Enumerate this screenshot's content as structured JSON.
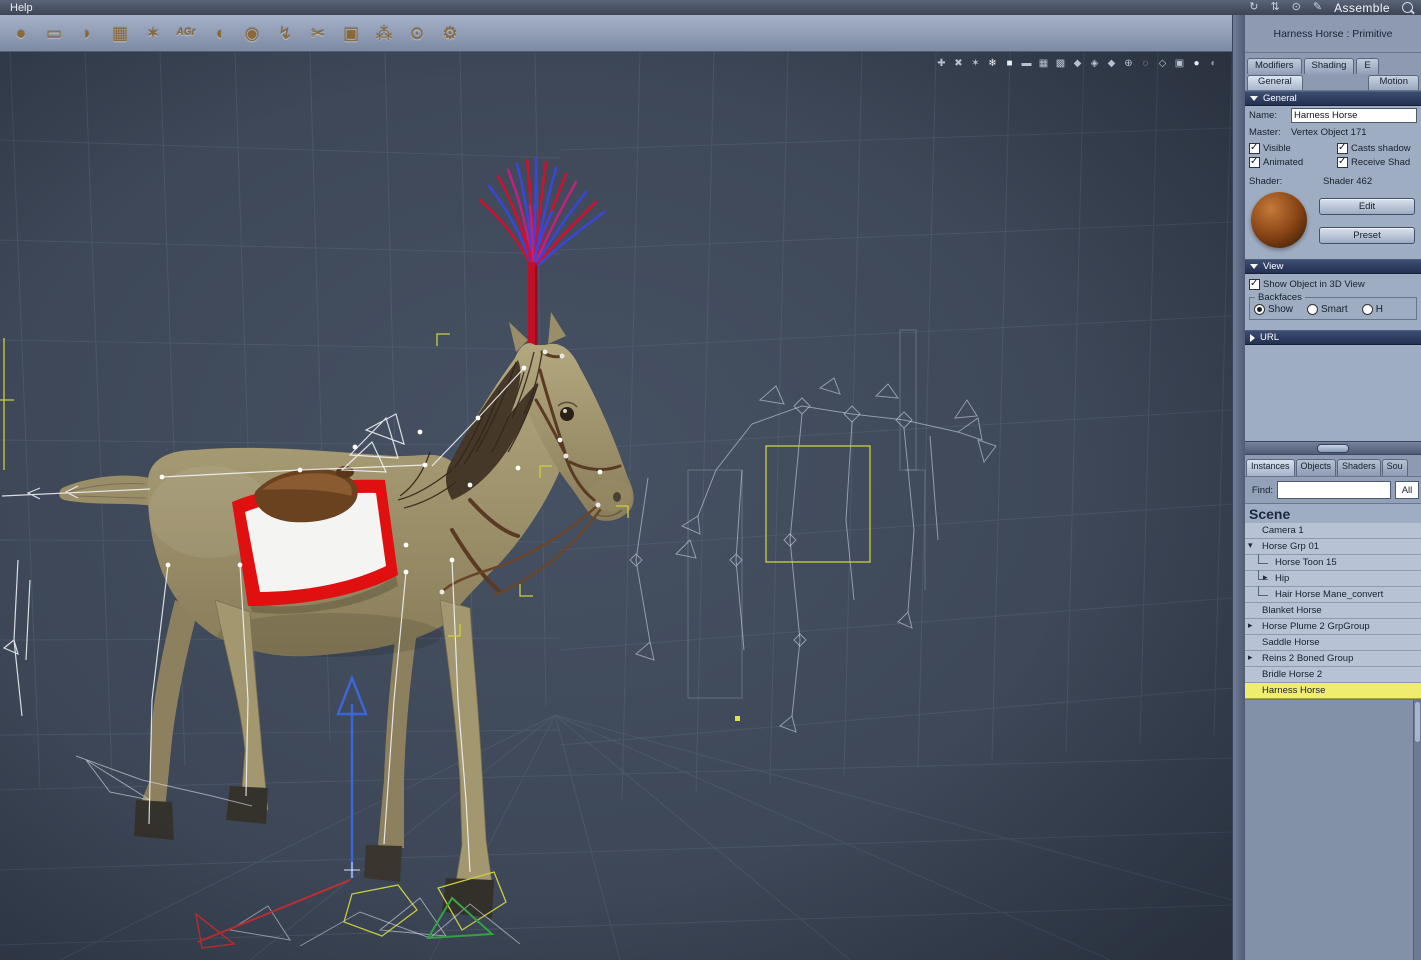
{
  "menubar": {
    "help_label": "Help",
    "assemble_label": "Assemble",
    "icons": [
      {
        "name": "rotate-hand-icon",
        "glyph": "↻"
      },
      {
        "name": "pan-hand-icon",
        "glyph": "⇅"
      },
      {
        "name": "zoom-hand-icon",
        "glyph": "⊙"
      },
      {
        "name": "annotate-icon",
        "glyph": "✎"
      }
    ]
  },
  "toolbar": {
    "tools": [
      {
        "name": "sphere-tool-icon",
        "glyph": "●"
      },
      {
        "name": "plane-tool-icon",
        "glyph": "▭"
      },
      {
        "name": "hand-tool-icon",
        "glyph": "◗"
      },
      {
        "name": "mesh-tool-icon",
        "glyph": "▦"
      },
      {
        "name": "star-tool-icon",
        "glyph": "✶"
      },
      {
        "name": "agr-tool-icon",
        "glyph": "AGr"
      },
      {
        "name": "shell-tool-icon",
        "glyph": "◖"
      },
      {
        "name": "blob-tool-icon",
        "glyph": "◉"
      },
      {
        "name": "bolt-tool-icon",
        "glyph": "↯"
      },
      {
        "name": "scissors-tool-icon",
        "glyph": "✂"
      },
      {
        "name": "camera-tool-icon",
        "glyph": "▣"
      },
      {
        "name": "particles-tool-icon",
        "glyph": "⁂"
      },
      {
        "name": "target-tool-icon",
        "glyph": "⊙"
      },
      {
        "name": "wrench-tool-icon",
        "glyph": "⚙"
      }
    ]
  },
  "viewport": {
    "icons": [
      {
        "name": "plus-tool-icon",
        "glyph": "✚"
      },
      {
        "name": "delete-tool-icon",
        "glyph": "✖"
      },
      {
        "name": "sparkle-icon",
        "glyph": "✶"
      },
      {
        "name": "snowflake-icon",
        "glyph": "❄"
      },
      {
        "name": "solid-mode-icon",
        "glyph": "■"
      },
      {
        "name": "bars-mode-icon",
        "glyph": "▬"
      },
      {
        "name": "grid-mode-icon",
        "glyph": "▦"
      },
      {
        "name": "dense-grid-mode-icon",
        "glyph": "▩"
      },
      {
        "name": "shield-wire-icon",
        "glyph": "◆"
      },
      {
        "name": "shield-flat-icon",
        "glyph": "◈"
      },
      {
        "name": "shield-textured-icon",
        "glyph": "◆"
      },
      {
        "name": "orbit-icon",
        "glyph": "⊕"
      },
      {
        "name": "dashed-circle-icon",
        "glyph": "◌"
      },
      {
        "name": "diamond-wire-icon",
        "glyph": "◇"
      },
      {
        "name": "cube-icon",
        "glyph": "▣"
      },
      {
        "name": "white-sphere-icon",
        "glyph": "●"
      },
      {
        "name": "gray-sphere-icon",
        "glyph": "◐"
      }
    ]
  },
  "panel": {
    "title": "Harness Horse : Primitive",
    "tabs": [
      {
        "label": "Modifiers"
      },
      {
        "label": "Shading"
      },
      {
        "label": "E"
      }
    ],
    "subtabs": [
      {
        "label": "General"
      },
      {
        "label": "Motion"
      }
    ],
    "general": {
      "header": "General",
      "name_label": "Name:",
      "name_value": "Harness Horse",
      "master_label": "Master:",
      "master_value": "Vertex Object 171",
      "visible_label": "Visible",
      "animated_label": "Animated",
      "casts_label": "Casts shadow",
      "receive_label": "Receive Shad",
      "shader_label": "Shader:",
      "shader_value": "Shader 462",
      "edit_label": "Edit",
      "preset_label": "Preset"
    },
    "view": {
      "header": "View",
      "show_object_label": "Show Object in 3D View",
      "backfaces_label": "Backfaces",
      "radio_show": "Show",
      "radio_smart": "Smart",
      "radio_hidden": "H"
    },
    "url_label": "URL",
    "browser": {
      "tabs": [
        {
          "label": "Instances"
        },
        {
          "label": "Objects"
        },
        {
          "label": "Shaders"
        },
        {
          "label": "Sou"
        }
      ],
      "find_label": "Find:",
      "all_label": "All",
      "scene_label": "Scene",
      "tree": [
        {
          "label": "Camera 1",
          "toggle": ""
        },
        {
          "label": "Horse Grp 01",
          "toggle": "▾"
        },
        {
          "label": "Horse Toon 15",
          "toggle": ""
        },
        {
          "label": "Hip",
          "toggle": "▸"
        },
        {
          "label": "Hair Horse Mane_convert",
          "toggle": ""
        },
        {
          "label": "Blanket Horse",
          "toggle": ""
        },
        {
          "label": "Horse Plume 2 GrpGroup",
          "toggle": "▸"
        },
        {
          "label": "Saddle Horse",
          "toggle": ""
        },
        {
          "label": "Reins 2 Boned Group",
          "toggle": "▸"
        },
        {
          "label": "Bridle Horse 2",
          "toggle": ""
        },
        {
          "label": "Harness Horse",
          "toggle": "",
          "selected": true
        }
      ]
    },
    "colors": {
      "selection_yellow": "#efec70",
      "header_navy": "#233153",
      "panel_bg": "#9fadc2",
      "viewport_bg": "#3f4859",
      "plume_red": "#cf1030",
      "plume_blue": "#3946d6",
      "blanket_red": "#e01010",
      "horse_tan": "#a79b74"
    }
  }
}
